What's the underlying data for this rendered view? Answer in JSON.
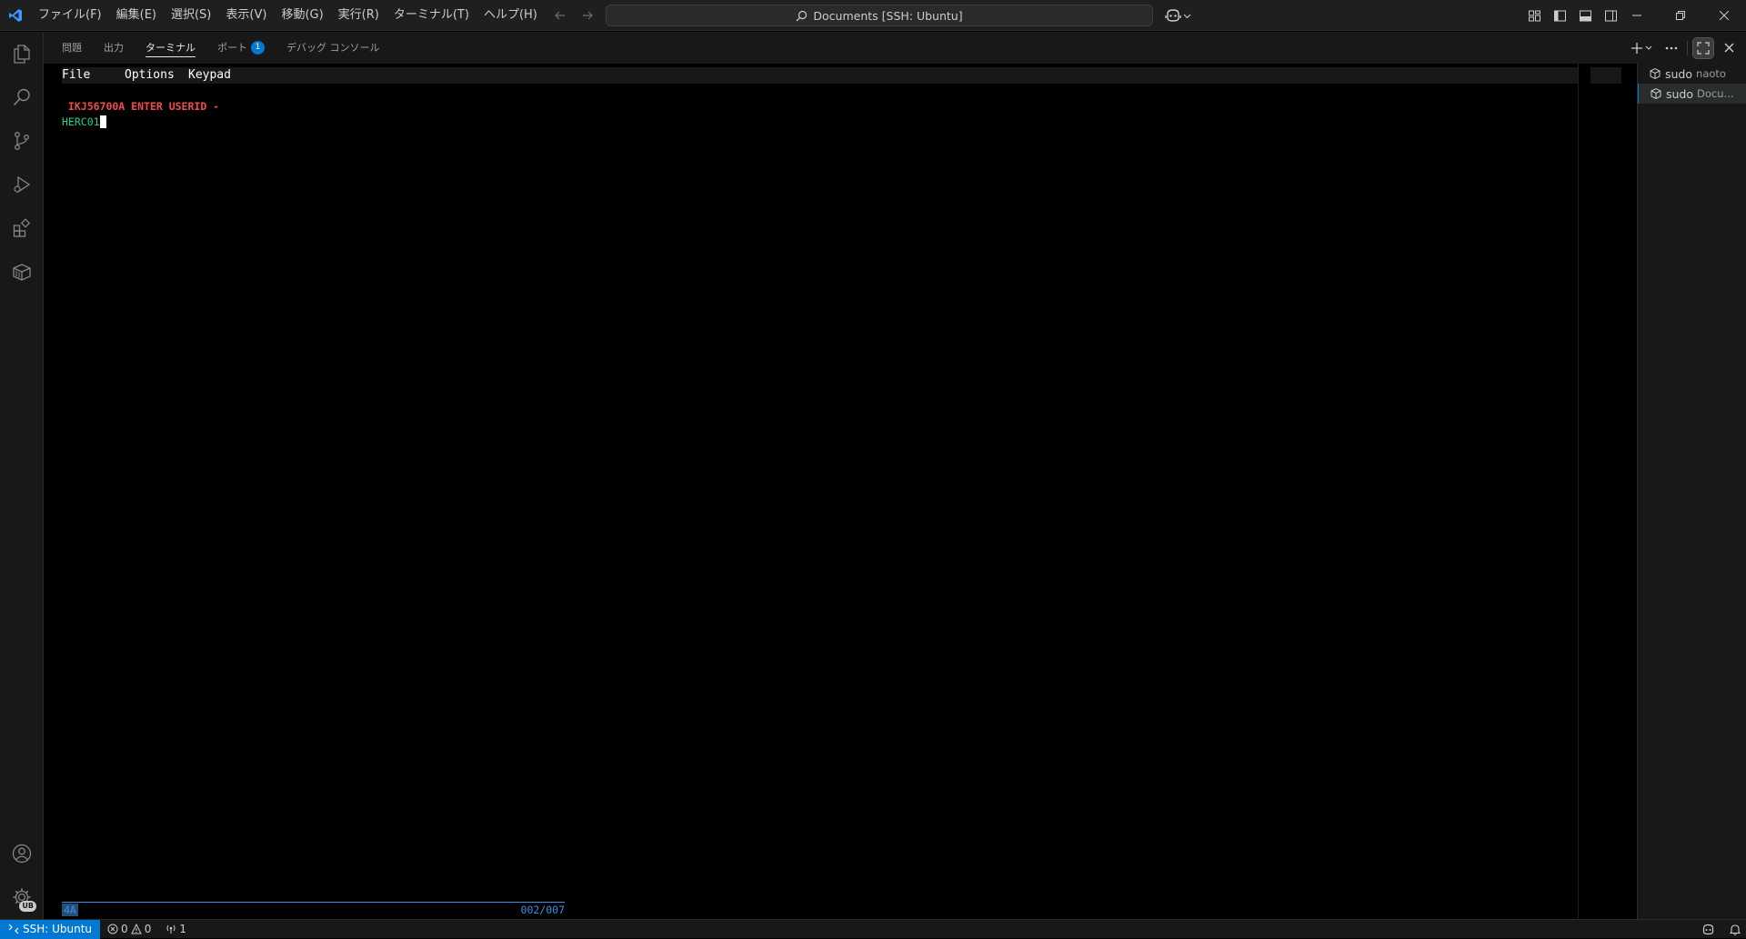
{
  "titlebar": {
    "menu": [
      "ファイル(F)",
      "編集(E)",
      "選択(S)",
      "表示(V)",
      "移動(G)",
      "実行(R)",
      "ターミナル(T)",
      "ヘルプ(H)"
    ],
    "command_center": "Documents [SSH: Ubuntu]"
  },
  "panel": {
    "tabs": [
      {
        "label": "問題"
      },
      {
        "label": "出力"
      },
      {
        "label": "ターミナル"
      },
      {
        "label": "ポート",
        "badge": "1"
      },
      {
        "label": "デバッグ コンソール"
      }
    ]
  },
  "terminal": {
    "menu": [
      "File",
      "Options",
      "Keypad"
    ],
    "message": " IKJ56700A ENTER USERID -",
    "input": "HERC01",
    "status_left": "4A",
    "status_right": "002/007"
  },
  "terminal_tabs": [
    {
      "name": "sudo",
      "desc": "naoto"
    },
    {
      "name": "sudo",
      "desc": "Docu..."
    }
  ],
  "activitybar": {
    "account_badge": "UB"
  },
  "statusbar": {
    "remote": "SSH: Ubuntu",
    "errors": "0",
    "warnings": "0",
    "ports": "1"
  },
  "colors": {
    "accent": "#0078d4",
    "error_text": "#f14c4c",
    "input_text": "#23d18b",
    "status_blue": "#3b8eea"
  }
}
